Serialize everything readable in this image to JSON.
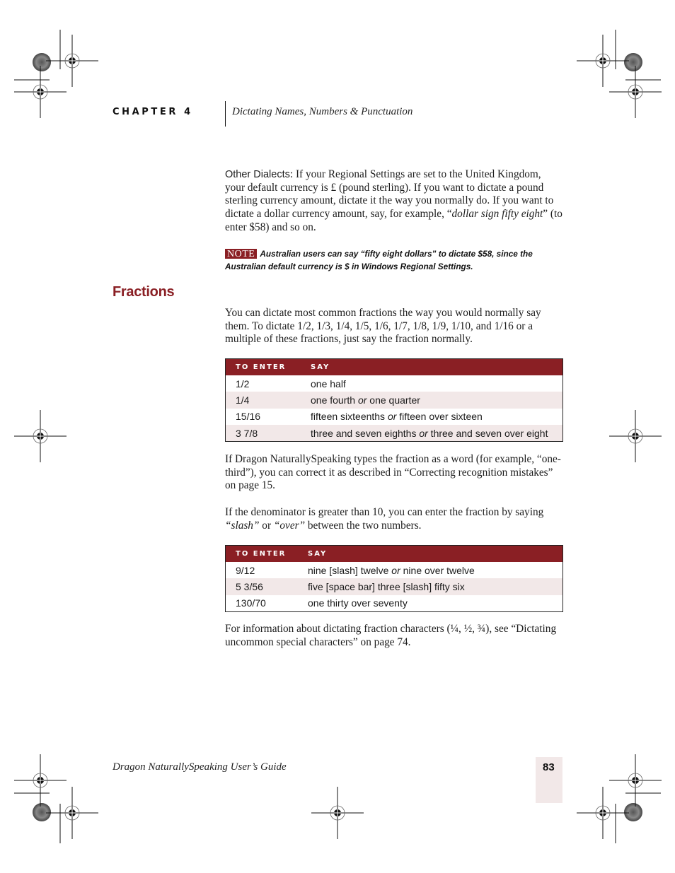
{
  "header": {
    "chapter_label": "CHAPTER 4",
    "chapter_title": "Dictating Names, Numbers & Punctuation"
  },
  "dialects_paragraph": {
    "lead": "Other Dialects",
    "text_1": ": If your Regional Settings are set to the United Kingdom, your default currency is £ (pound sterling). If you want to dictate a pound sterling currency amount, dictate it the way you normally do. If you want to dictate a dollar currency amount, say, for example, “",
    "italic": "dollar sign fifty eight",
    "text_2": "” (to enter $58) and so on."
  },
  "note": {
    "badge": "NOTE",
    "text": "Australian users can say “fifty eight dollars” to dictate $58, since the Australian default currency is $ in Windows Regional Settings."
  },
  "section": {
    "heading": "Fractions",
    "intro": "You can dictate most common fractions the way you would normally say them. To dictate 1/2, 1/3, 1/4, 1/5, 1/6, 1/7, 1/8, 1/9, 1/10, and 1/16 or a multiple of these fractions, just say the fraction normally."
  },
  "table1": {
    "headers": [
      "TO ENTER",
      "SAY"
    ],
    "rows": [
      {
        "enter": "1/2",
        "say_a": "one half",
        "or": "",
        "say_b": ""
      },
      {
        "enter": "1/4",
        "say_a": "one fourth ",
        "or": "or",
        "say_b": " one quarter"
      },
      {
        "enter": "15/16",
        "say_a": "fifteen sixteenths ",
        "or": "or",
        "say_b": " fifteen over sixteen"
      },
      {
        "enter": "3 7/8",
        "say_a": "three and seven eighths ",
        "or": "or",
        "say_b": " three and seven over eight"
      }
    ]
  },
  "paragraph_correct": "If Dragon NaturallySpeaking types the fraction as a word (for example, “one-third”), you can correct it as described in “Correcting recognition mistakes” on page 15.",
  "paragraph_denominator": {
    "text_1": "If the denominator is greater than 10, you can enter the fraction by saying ",
    "italic_1": "“slash”",
    "text_2": " or ",
    "italic_2": "“over”",
    "text_3": " between the two numbers."
  },
  "table2": {
    "headers": [
      "TO ENTER",
      "SAY"
    ],
    "rows": [
      {
        "enter": "9/12",
        "say_a": "nine [slash] twelve ",
        "or": "or",
        "say_b": " nine over twelve"
      },
      {
        "enter": "5 3/56",
        "say_a": "five [space bar] three [slash] fifty six",
        "or": "",
        "say_b": ""
      },
      {
        "enter": "130/70",
        "say_a": "one thirty over seventy",
        "or": "",
        "say_b": ""
      }
    ]
  },
  "paragraph_characters": "For information about dictating fraction characters (¼, ½, ¾), see “Dictating uncommon special characters” on page 74.",
  "footer": {
    "book_title": "Dragon NaturallySpeaking User’s Guide",
    "page_number": "83"
  },
  "colors": {
    "accent": "#8a1f24",
    "row_tint": "#f2e8e8"
  }
}
